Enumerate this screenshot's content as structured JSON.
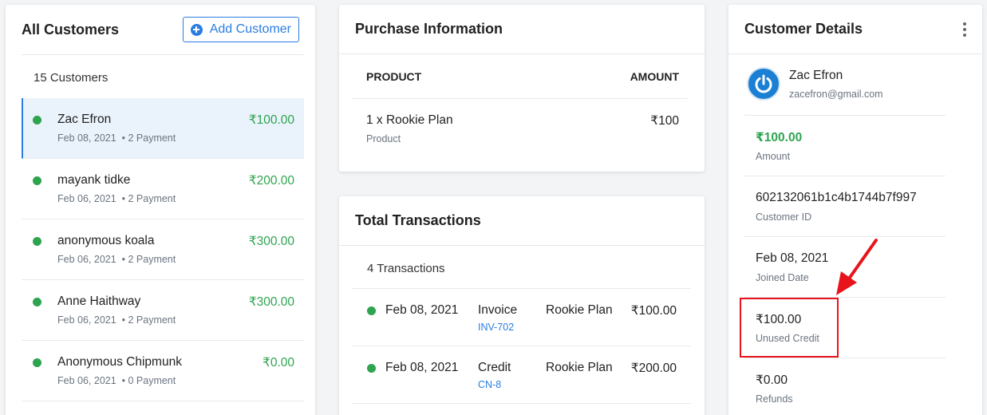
{
  "customers": {
    "title": "All Customers",
    "add_label": "Add Customer",
    "count_text": "15 Customers",
    "items": [
      {
        "name": "Zac Efron",
        "date": "Feb 08, 2021",
        "payments": "• 2 Payment",
        "amount": "₹100.00"
      },
      {
        "name": "mayank tidke",
        "date": "Feb 06, 2021",
        "payments": "• 2 Payment",
        "amount": "₹200.00"
      },
      {
        "name": "anonymous koala",
        "date": "Feb 06, 2021",
        "payments": "• 2 Payment",
        "amount": "₹300.00"
      },
      {
        "name": "Anne Haithway",
        "date": "Feb 06, 2021",
        "payments": "• 2 Payment",
        "amount": "₹300.00"
      },
      {
        "name": "Anonymous Chipmunk",
        "date": "Feb 06, 2021",
        "payments": "• 0 Payment",
        "amount": "₹0.00"
      }
    ]
  },
  "purchase": {
    "title": "Purchase Information",
    "col_product": "PRODUCT",
    "col_amount": "AMOUNT",
    "row": {
      "product": "1 x Rookie Plan",
      "sub": "Product",
      "amount": "₹100"
    }
  },
  "transactions": {
    "title": "Total Transactions",
    "count_text": "4 Transactions",
    "items": [
      {
        "date": "Feb 08, 2021",
        "type": "Invoice",
        "ref": "INV-702",
        "plan": "Rookie Plan",
        "amount": "₹100.00"
      },
      {
        "date": "Feb 08, 2021",
        "type": "Credit",
        "ref": "CN-8",
        "plan": "Rookie Plan",
        "amount": "₹200.00"
      }
    ]
  },
  "details": {
    "title": "Customer Details",
    "name": "Zac Efron",
    "email": "zacefron@gmail.com",
    "fields": [
      {
        "value": "₹100.00",
        "label": "Amount"
      },
      {
        "value": "602132061b1c4b1744b7f997",
        "label": "Customer ID"
      },
      {
        "value": "Feb 08, 2021",
        "label": "Joined Date"
      },
      {
        "value": "₹100.00",
        "label": "Unused Credit"
      },
      {
        "value": "₹0.00",
        "label": "Refunds"
      }
    ]
  },
  "colors": {
    "accent": "#2a7de1",
    "positive": "#2ea44f",
    "annotation": "#e8141b"
  },
  "icons": [
    "plus-circle-icon",
    "kebab-menu-icon",
    "avatar-power-icon",
    "annotation-arrow"
  ]
}
